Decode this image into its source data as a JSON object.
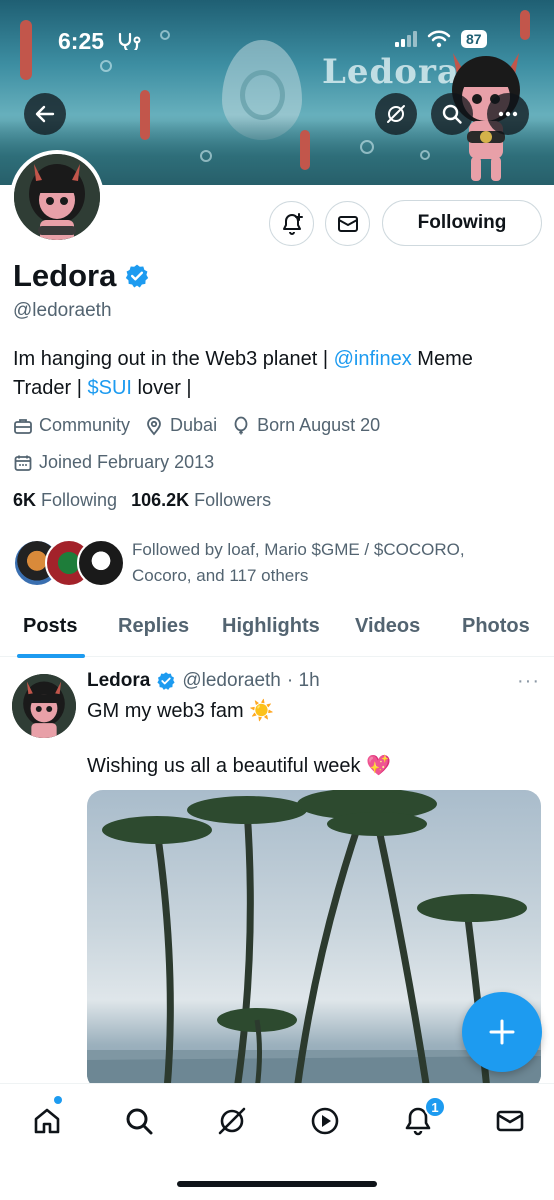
{
  "status_bar": {
    "time": "6:25",
    "battery": "87"
  },
  "banner": {
    "brand_text": "Ledora"
  },
  "profile": {
    "name": "Ledora",
    "handle": "@ledoraeth",
    "bio_part1": "Im hanging out in the Web3 planet | ",
    "bio_mention": "@infinex",
    "bio_part2": " Meme Trader | ",
    "bio_cashtag": "$SUI",
    "bio_part3": " lover |",
    "category": "Community",
    "location": "Dubai",
    "birthday": "Born August 20",
    "joined": "Joined February 2013",
    "following_count": "6K",
    "following_label": "Following",
    "followers_count": "106.2K",
    "followers_label": "Followers",
    "followed_by": "Followed by loaf, Mario $GME / $COCORO, Cocoro, and 117 others"
  },
  "actions": {
    "following_label": "Following"
  },
  "tabs": [
    "Posts",
    "Replies",
    "Highlights",
    "Videos",
    "Photos"
  ],
  "post": {
    "name": "Ledora",
    "handle": "@ledoraeth",
    "time": "· 1h",
    "more": "···",
    "line1": "GM my web3 fam ☀️",
    "line2": "Wishing us all a beautiful week 💖"
  },
  "nav": {
    "notification_badge": "1"
  },
  "colors": {
    "accent": "#1d9bf0",
    "text": "#0f1419",
    "muted": "#536471"
  }
}
